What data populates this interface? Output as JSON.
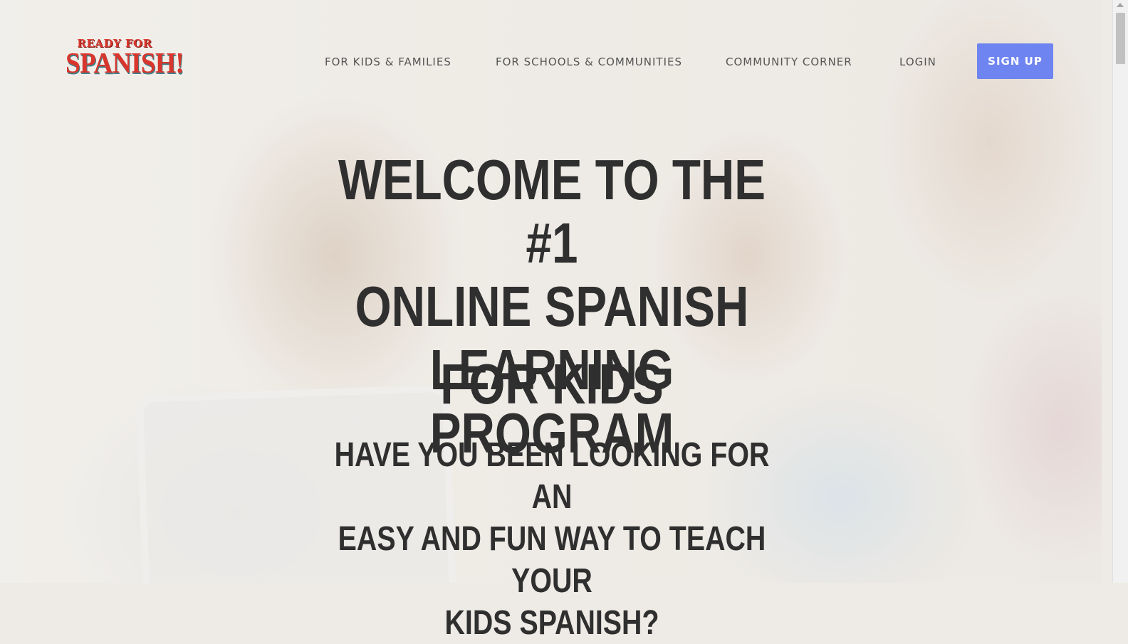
{
  "logo": {
    "top": "READY FOR",
    "main": "SPANISH!"
  },
  "nav": {
    "links": [
      "FOR KIDS & FAMILIES",
      "FOR SCHOOLS & COMMUNITIES",
      "COMMUNITY CORNER",
      "LOGIN"
    ],
    "signup": "SIGN UP"
  },
  "hero": {
    "title_lines": [
      "WELCOME TO THE #1",
      "ONLINE SPANISH",
      "LEARNING PROGRAM"
    ],
    "subtitle": "FOR KIDS",
    "question_lines": [
      "HAVE YOU BEEN LOOKING FOR AN",
      "EASY AND FUN WAY TO TEACH YOUR",
      "KIDS SPANISH?"
    ]
  },
  "colors": {
    "accent": "#6e84f0",
    "logo_red": "#d8362d",
    "text": "#2f2f2f"
  }
}
